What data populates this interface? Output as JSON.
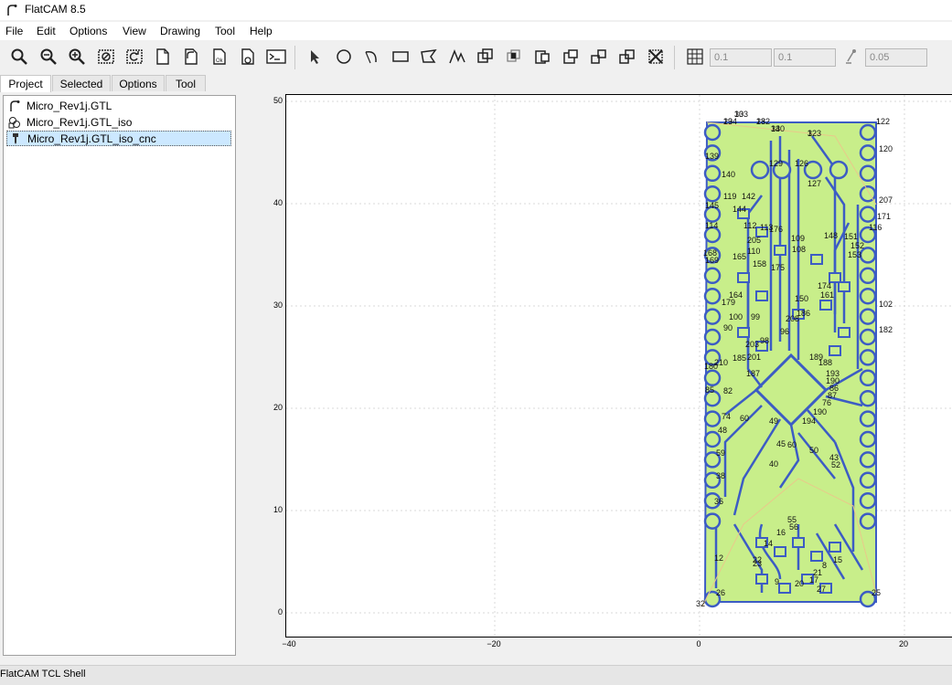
{
  "window": {
    "title": "FlatCAM 8.5"
  },
  "menu": [
    "File",
    "Edit",
    "Options",
    "View",
    "Drawing",
    "Tool",
    "Help"
  ],
  "toolbar": {
    "view_buttons": [
      "zoom-fit-icon",
      "zoom-out-icon",
      "zoom-in-icon",
      "clear-plot-icon",
      "replot-icon",
      "new-project-icon",
      "open-gerber-icon",
      "open-excellon-icon",
      "open-gcode-icon",
      "tcl-shell-icon"
    ],
    "draw_buttons": [
      "select-icon",
      "circle-icon",
      "arc-icon",
      "rectangle-icon",
      "polygon-icon",
      "path-icon",
      "union-icon",
      "intersection-icon",
      "subtract-icon",
      "cutout-icon",
      "copy-icon",
      "move-icon",
      "delete-icon"
    ],
    "grid_x": "0.1",
    "grid_y": "0.1",
    "snap_distance": "0.05"
  },
  "tabs": [
    "Project",
    "Selected",
    "Options",
    "Tool"
  ],
  "active_tab": "Project",
  "project_items": [
    {
      "name": "Micro_Rev1j.GTL",
      "icon": "gerber-icon"
    },
    {
      "name": "Micro_Rev1j.GTL_iso",
      "icon": "geometry-icon"
    },
    {
      "name": "Micro_Rev1j.GTL_iso_cnc",
      "icon": "cnc-icon"
    }
  ],
  "selected_item": "Micro_Rev1j.GTL_iso_cnc",
  "plot": {
    "y_ticks": [
      "50",
      "40",
      "30",
      "20",
      "10",
      "0"
    ],
    "x_ticks": [
      "−40",
      "−20",
      "0",
      "20"
    ],
    "board_fill": "#c8ee8a",
    "trace_color": "#3c5cc4",
    "point_labels": [
      "133",
      "134",
      "132",
      "130",
      "123",
      "122",
      "120",
      "139",
      "140",
      "129",
      "126",
      "127",
      "207",
      "119",
      "142",
      "145",
      "171",
      "144",
      "116",
      "114",
      "112",
      "113",
      "176",
      "148",
      "151",
      "152",
      "153",
      "205",
      "110",
      "109",
      "108",
      "169",
      "168",
      "165",
      "158",
      "175",
      "174",
      "164",
      "161",
      "150",
      "102",
      "179",
      "100",
      "99",
      "208",
      "186",
      "182",
      "203",
      "98",
      "96",
      "90",
      "210",
      "185",
      "201",
      "180",
      "187",
      "189",
      "188",
      "193",
      "190",
      "82",
      "85",
      "86",
      "87",
      "76",
      "190",
      "194",
      "74",
      "60",
      "49",
      "48",
      "45",
      "60",
      "50",
      "43",
      "52",
      "40",
      "59",
      "38",
      "36",
      "55",
      "56",
      "16",
      "14",
      "12",
      "15",
      "8",
      "22",
      "23",
      "21",
      "9",
      "20",
      "17",
      "27",
      "25",
      "26",
      "32",
      "30",
      "29",
      "28",
      "34",
      "3",
      "1"
    ]
  },
  "status": {
    "shell": "FlatCAM TCL Shell"
  }
}
